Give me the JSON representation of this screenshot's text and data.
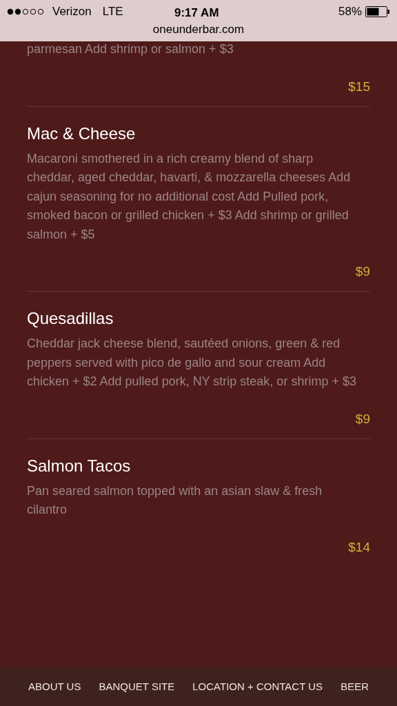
{
  "status_bar": {
    "carrier": "Verizon",
    "network": "LTE",
    "time": "9:17 AM",
    "battery": "58%"
  },
  "url": "oneunderbar.com",
  "menu_items": [
    {
      "description": "parmesan Add shrimp or salmon + $3",
      "price": "$15"
    },
    {
      "name": "Mac & Cheese",
      "description": "Macaroni smothered in a rich creamy blend of sharp cheddar, aged cheddar, havarti, & mozzarella cheeses Add cajun seasoning for no additional cost Add Pulled pork, smoked bacon or grilled chicken + $3 Add shrimp or grilled salmon + $5",
      "price": "$9"
    },
    {
      "name": "Quesadillas",
      "description": "Cheddar jack cheese blend, sautéed onions, green & red peppers served with pico de gallo and sour cream Add chicken + $2 Add pulled pork, NY strip steak, or shrimp + $3",
      "price": "$9"
    },
    {
      "name": "Salmon Tacos",
      "description": "Pan seared salmon topped with an asian slaw & fresh cilantro",
      "price": "$14"
    }
  ],
  "footer_links": [
    "ABOUT US",
    "BANQUET SITE",
    "LOCATION + CONTACT US",
    "BEER"
  ]
}
